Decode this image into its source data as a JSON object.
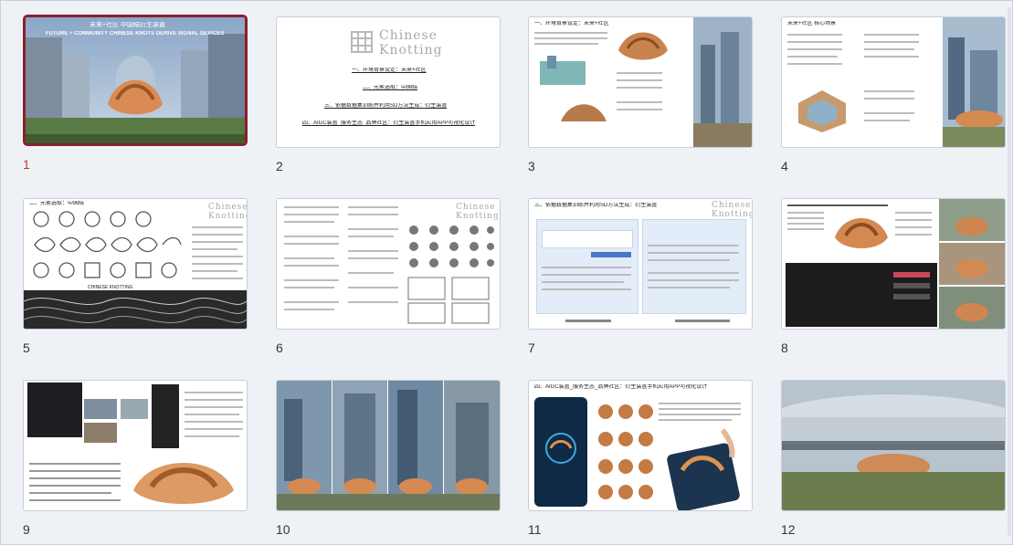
{
  "window": {
    "title": ""
  },
  "slides": [
    {
      "number": "1",
      "selected": true,
      "title": "未来+社区 中国结衍生装置",
      "subtitle": "FUTURE + COMMUNITY CHINESE KNOTS DERIVE SIGNAL DEVICES"
    },
    {
      "number": "2",
      "logo_line1": "Chinese",
      "logo_line2": "Knotting",
      "lines": [
        "一、环境背景设定：未来+社区",
        "二、元素选取：中国结",
        "三、依据数据集训练并利用SD方法生成：衍生装置",
        "四、AIGC装置_服务生态_品牌社区：衍生装置手机应用APP可视化设计"
      ]
    },
    {
      "number": "3",
      "heading": "一、环境背景设定：未来+社区"
    },
    {
      "number": "4",
      "heading": "未来+社区 核心场景"
    },
    {
      "number": "5",
      "heading": "二、元素选取：中国结",
      "logo_line1": "Chinese",
      "logo_line2": "Knotting",
      "caption": "CHINESE KNOTTING"
    },
    {
      "number": "6",
      "logo_line1": "Chinese",
      "logo_line2": "Knotting"
    },
    {
      "number": "7",
      "heading": "三、依据数据集训练并利用SD方法生成：衍生装置",
      "logo_line1": "Chinese",
      "logo_line2": "Knotting"
    },
    {
      "number": "8"
    },
    {
      "number": "9"
    },
    {
      "number": "10"
    },
    {
      "number": "11",
      "heading": "四、AIGC装置_服务生态_品牌社区：衍生装置手机应用APP可视化设计"
    },
    {
      "number": "12"
    }
  ],
  "colors": {
    "selected_border": "#8b1f2b",
    "selected_number": "#c0392b",
    "background": "#eef2f7"
  }
}
